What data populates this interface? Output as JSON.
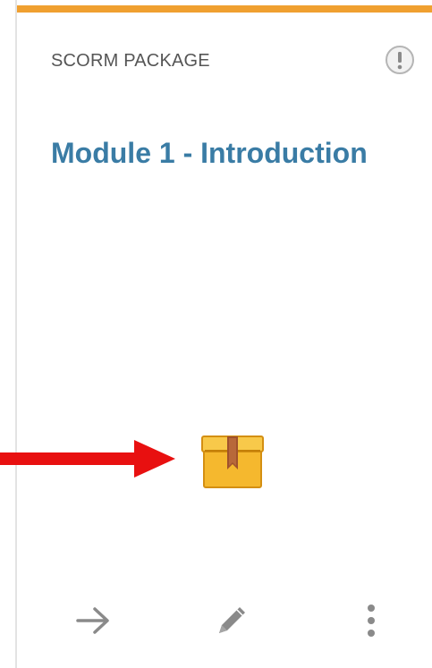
{
  "card": {
    "type_label": "SCORM PACKAGE",
    "title": "Module 1 - Introduction"
  },
  "icons": {
    "info": "exclamation-info-icon",
    "package": "package-box-icon",
    "open": "arrow-right-icon",
    "edit": "pencil-icon",
    "more": "more-vertical-icon",
    "annotation": "red-pointer-arrow"
  },
  "colors": {
    "accent": "#f0a030",
    "title": "#3a7ca5",
    "label": "#555555",
    "icon_gray": "#888888",
    "annotation": "#e81010",
    "package_body": "#f5b82e",
    "package_ribbon": "#a0522d"
  }
}
